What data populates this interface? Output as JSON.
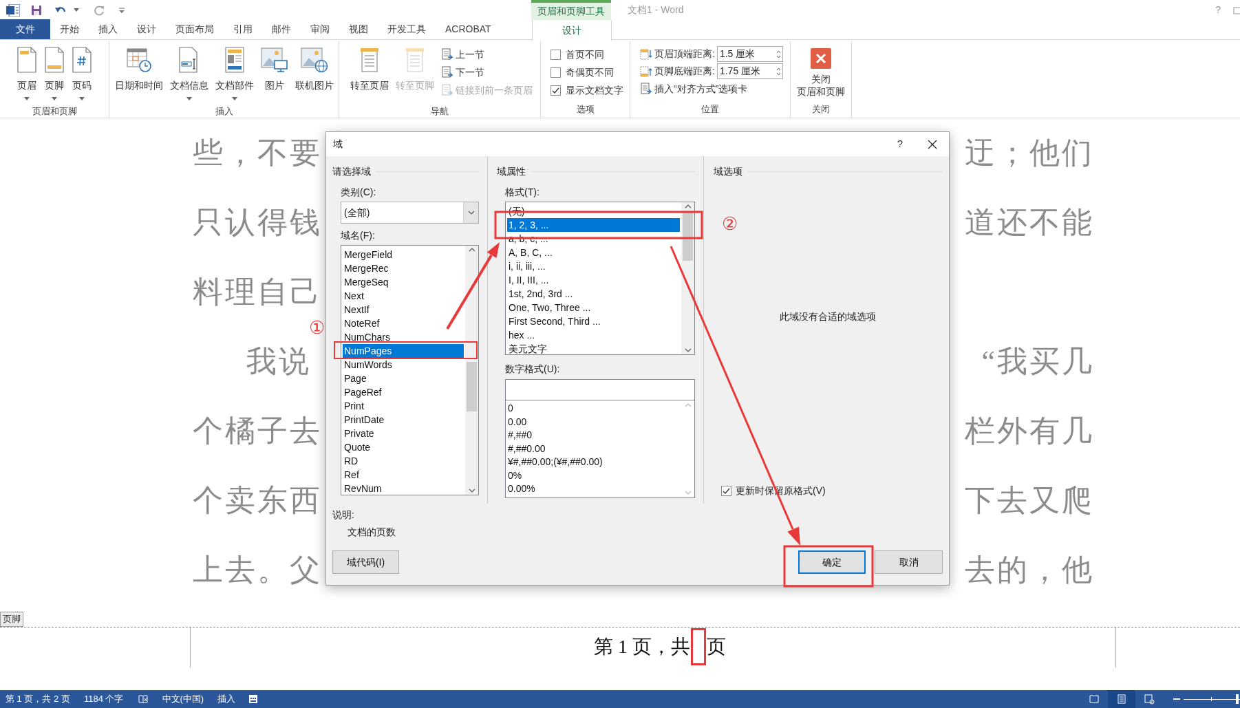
{
  "title_bar": {
    "contextual_group": "页眉和页脚工具",
    "title": "文档1 - Word",
    "help": "?"
  },
  "tabs": [
    {
      "label": "文件",
      "kind": "file",
      "selected": false
    },
    {
      "label": "开始",
      "kind": "tab",
      "selected": false
    },
    {
      "label": "插入",
      "kind": "tab",
      "selected": false
    },
    {
      "label": "设计",
      "kind": "tab",
      "selected": false
    },
    {
      "label": "页面布局",
      "kind": "tab",
      "selected": false
    },
    {
      "label": "引用",
      "kind": "tab",
      "selected": false
    },
    {
      "label": "邮件",
      "kind": "tab",
      "selected": false
    },
    {
      "label": "审阅",
      "kind": "tab",
      "selected": false
    },
    {
      "label": "视图",
      "kind": "tab",
      "selected": false
    },
    {
      "label": "开发工具",
      "kind": "tab",
      "selected": false
    },
    {
      "label": "ACROBAT",
      "kind": "tab",
      "selected": false
    },
    {
      "label": "设计",
      "kind": "context",
      "selected": true
    }
  ],
  "ribbon": {
    "groups": [
      {
        "label": "页眉和页脚",
        "items": [
          {
            "kind": "large",
            "label": "页眉",
            "dropdown": true,
            "disabled": false
          },
          {
            "kind": "large",
            "label": "页脚",
            "dropdown": true,
            "disabled": false
          },
          {
            "kind": "large",
            "label": "页码",
            "dropdown": true,
            "disabled": false
          }
        ]
      },
      {
        "label": "插入",
        "items": [
          {
            "kind": "large",
            "label": "日期和时间",
            "dropdown": false,
            "disabled": false
          },
          {
            "kind": "large",
            "label": "文档信息",
            "dropdown": true,
            "disabled": false
          },
          {
            "kind": "large",
            "label": "文档部件",
            "dropdown": true,
            "disabled": false
          },
          {
            "kind": "large",
            "label": "图片",
            "dropdown": false,
            "disabled": false
          },
          {
            "kind": "large",
            "label": "联机图片",
            "dropdown": false,
            "disabled": false
          }
        ]
      },
      {
        "label": "导航",
        "items": [
          {
            "kind": "large",
            "label": "转至页眉",
            "dropdown": false,
            "disabled": false
          },
          {
            "kind": "large",
            "label": "转至页脚",
            "dropdown": false,
            "disabled": true
          },
          {
            "kind": "small",
            "label": "上一节",
            "disabled": false
          },
          {
            "kind": "small",
            "label": "下一节",
            "disabled": false
          },
          {
            "kind": "small",
            "label": "链接到前一条页眉",
            "disabled": true
          }
        ]
      },
      {
        "label": "选项",
        "items": [
          {
            "kind": "checkbox",
            "label": "首页不同",
            "checked": false
          },
          {
            "kind": "checkbox",
            "label": "奇偶页不同",
            "checked": false
          },
          {
            "kind": "checkbox",
            "label": "显示文档文字",
            "checked": true
          }
        ]
      },
      {
        "label": "位置",
        "items": [
          {
            "kind": "spinner",
            "label": "页眉顶端距离:",
            "value": "1.5 厘米"
          },
          {
            "kind": "spinner",
            "label": "页脚底端距离:",
            "value": "1.75 厘米"
          },
          {
            "kind": "small",
            "label": "插入“对齐方式”选项卡",
            "disabled": false
          }
        ]
      },
      {
        "label": "关闭",
        "items": [
          {
            "kind": "close",
            "lines": [
              "关闭",
              "页眉和页脚"
            ]
          }
        ]
      }
    ]
  },
  "document": {
    "lines": [
      {
        "left": "些，不要",
        "right": "迂；他们",
        "indent": false
      },
      {
        "left": "只认得钱",
        "right": "道还不能",
        "indent": false
      },
      {
        "left": "料理自己",
        "indent": false
      },
      {
        "left": "我说",
        "right": "“我买几",
        "indent": true
      },
      {
        "left": "个橘子去",
        "right": "栏外有几",
        "indent": false
      },
      {
        "left": "个卖东西",
        "right": "下去又爬",
        "indent": false
      },
      {
        "left": "上去。父",
        "right": "去的，他",
        "indent": false
      }
    ]
  },
  "footer": {
    "tag": "页脚",
    "text_before_field": "第 1 页，共",
    "text_after_field": "页"
  },
  "dialog": {
    "title": "域",
    "help": "?",
    "choose": {
      "heading": "请选择域",
      "category_label": "类别(C):",
      "category_value": "(全部)",
      "names_label": "域名(F):",
      "names": [
        {
          "label": "MergeField",
          "selected": false
        },
        {
          "label": "MergeRec",
          "selected": false
        },
        {
          "label": "MergeSeq",
          "selected": false
        },
        {
          "label": "Next",
          "selected": false
        },
        {
          "label": "NextIf",
          "selected": false
        },
        {
          "label": "NoteRef",
          "selected": false
        },
        {
          "label": "NumChars",
          "selected": false
        },
        {
          "label": "NumPages",
          "selected": true
        },
        {
          "label": "NumWords",
          "selected": false
        },
        {
          "label": "Page",
          "selected": false
        },
        {
          "label": "PageRef",
          "selected": false
        },
        {
          "label": "Print",
          "selected": false
        },
        {
          "label": "PrintDate",
          "selected": false
        },
        {
          "label": "Private",
          "selected": false
        },
        {
          "label": "Quote",
          "selected": false
        },
        {
          "label": "RD",
          "selected": false
        },
        {
          "label": "Ref",
          "selected": false
        },
        {
          "label": "RevNum",
          "selected": false
        }
      ],
      "description_label": "说明:",
      "description": "文档的页数"
    },
    "properties": {
      "heading": "域属性",
      "format_label": "格式(T):",
      "formats": [
        {
          "label": "(无)",
          "selected": false
        },
        {
          "label": "1, 2, 3, ...",
          "selected": true
        },
        {
          "label": "a, b, c, ...",
          "selected": false
        },
        {
          "label": "A, B, C, ...",
          "selected": false
        },
        {
          "label": "i, ii, iii, ...",
          "selected": false
        },
        {
          "label": "I, II, III, ...",
          "selected": false
        },
        {
          "label": "1st, 2nd, 3rd ...",
          "selected": false
        },
        {
          "label": "One, Two, Three ...",
          "selected": false
        },
        {
          "label": "First Second, Third ...",
          "selected": false
        },
        {
          "label": "hex ...",
          "selected": false
        },
        {
          "label": "美元文字",
          "selected": false
        }
      ],
      "number_format_label": "数字格式(U):",
      "number_formats": [
        "0",
        "0.00",
        "#,##0",
        "#,##0.00",
        "¥#,##0.00;(¥#,##0.00)",
        "0%",
        "0.00%"
      ]
    },
    "options": {
      "heading": "域选项",
      "message": "此域没有合适的域选项",
      "preserve": {
        "label": "更新时保留原格式(V)",
        "checked": true
      }
    },
    "buttons": [
      {
        "label": "域代码(I)",
        "kind": "secondary"
      },
      {
        "label": "确定",
        "kind": "default"
      },
      {
        "label": "取消",
        "kind": "normal"
      }
    ]
  },
  "annotations": {
    "markers": [
      {
        "label": "①"
      },
      {
        "label": "②"
      }
    ]
  },
  "status_bar": {
    "page": "第 1 页，共 2 页",
    "words": "1184 个字",
    "language": "中文(中国)",
    "mode": "插入",
    "views": [
      {
        "selected": false
      },
      {
        "selected": true
      },
      {
        "selected": false
      }
    ],
    "zoom": {
      "level": 0.95
    }
  }
}
